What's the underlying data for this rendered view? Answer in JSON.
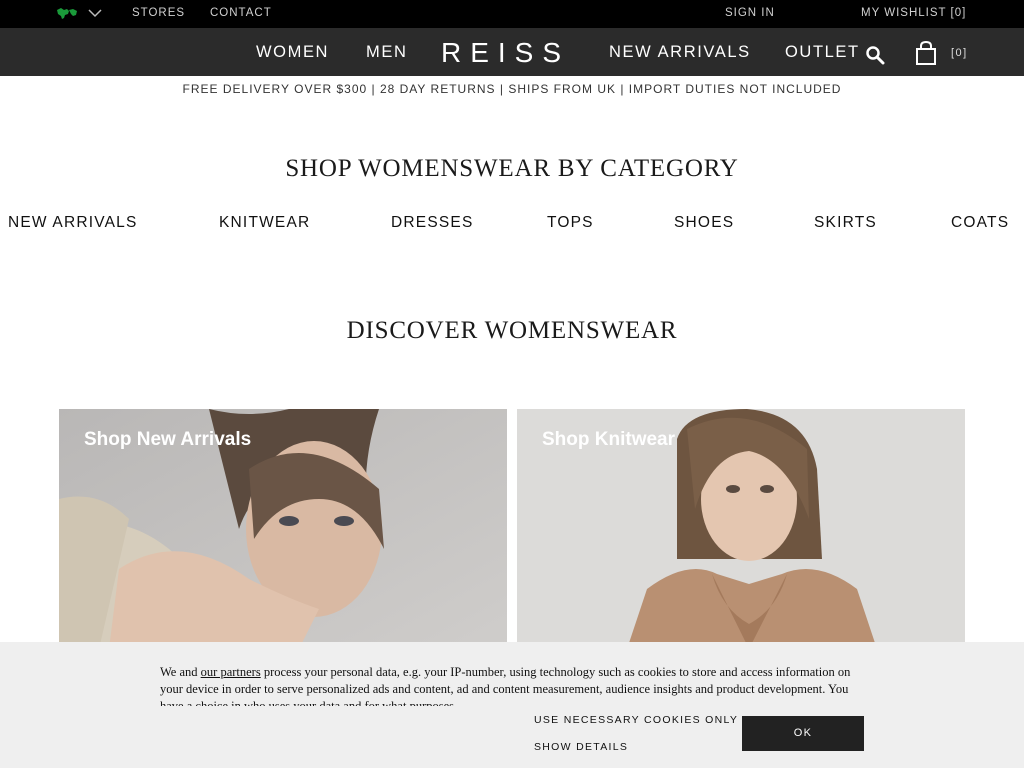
{
  "utility": {
    "stores": "STORES",
    "contact": "CONTACT",
    "sign_in": "SIGN IN",
    "wishlist": "MY WISHLIST [0]"
  },
  "nav": {
    "women": "WOMEN",
    "men": "MEN",
    "logo": "REISS",
    "new_arrivals": "NEW ARRIVALS",
    "outlet": "OUTLET",
    "bag_count": "[0]"
  },
  "promo": "FREE DELIVERY OVER $300 | 28 DAY RETURNS | SHIPS FROM UK | IMPORT DUTIES NOT INCLUDED",
  "category_section": {
    "title": "SHOP WOMENSWEAR BY CATEGORY",
    "items": [
      "NEW ARRIVALS",
      "KNITWEAR",
      "DRESSES",
      "TOPS",
      "SHOES",
      "SKIRTS",
      "COATS"
    ]
  },
  "discover": {
    "title": "DISCOVER WOMENSWEAR",
    "tiles": [
      {
        "label": "Shop New Arrivals"
      },
      {
        "label": "Shop Knitwear"
      }
    ]
  },
  "cookie": {
    "text_before": "We and ",
    "partners_link": "our partners",
    "text_after": " process your personal data, e.g. your IP-number, using technology such as cookies to store and access information on your device in order to serve personalized ads and content, ad and content measurement, audience insights and product development. You have a choice in who uses your data and for what purposes.",
    "necessary_only": "USE NECESSARY COOKIES ONLY",
    "show_details": "SHOW DETAILS",
    "ok": "OK"
  },
  "colors": {
    "utility_bg": "#000000",
    "nav_bg": "#2b2b2b",
    "flag_green": "#1a9a3a",
    "cookie_bg": "#efefef",
    "button_bg": "#222222"
  },
  "icons": {
    "flag": "region-flag-icon",
    "chevron": "chevron-down-icon",
    "search": "search-icon",
    "bag": "shopping-bag-icon"
  }
}
